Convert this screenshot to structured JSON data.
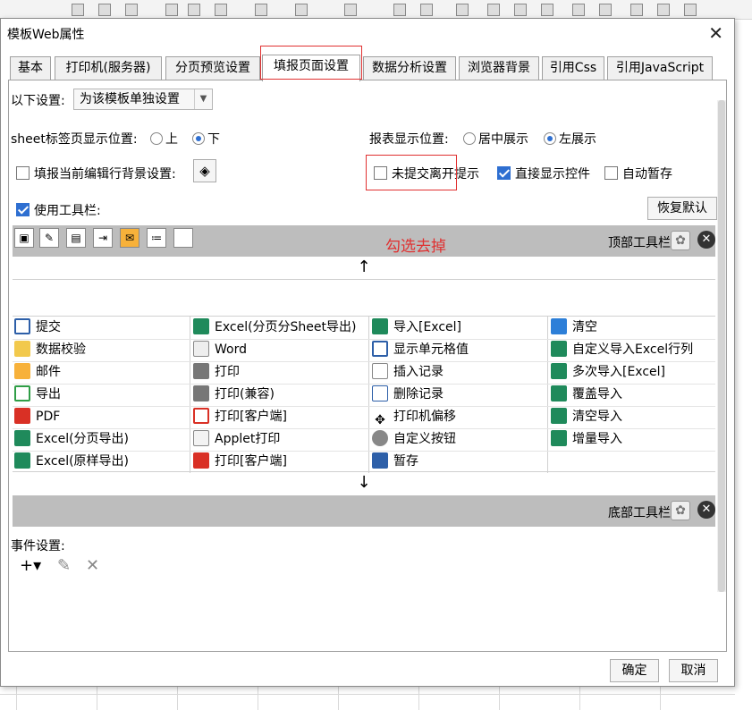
{
  "window": {
    "title": "模板Web属性"
  },
  "tabs": [
    "基本",
    "打印机(服务器)",
    "分页预览设置",
    "填报页面设置",
    "数据分析设置",
    "浏览器背景",
    "引用Css",
    "引用JavaScript"
  ],
  "settings": {
    "scope_label": "以下设置:",
    "scope_value": "为该模板单独设置",
    "sheet_pos_label": "sheet标签页显示位置:",
    "sheet_pos_top": "上",
    "sheet_pos_bottom": "下",
    "report_pos_label": "报表显示位置:",
    "report_pos_center": "居中展示",
    "report_pos_left": "左展示",
    "row_bg_label": "填报当前编辑行背景设置:",
    "unsubmitted_label": "未提交离开提示",
    "direct_controls_label": "直接显示控件",
    "autosave_label": "自动暂存",
    "use_toolbar_label": "使用工具栏:",
    "restore_default": "恢复默认",
    "annotation": "勾选去掉"
  },
  "toolbar": {
    "top_label": "顶部工具栏",
    "bottom_label": "底部工具栏",
    "up_arrow": "↑",
    "down_arrow": "↓"
  },
  "buttons": {
    "col1": [
      "提交",
      "数据校验",
      "邮件",
      "导出",
      "PDF",
      "Excel(分页导出)",
      "Excel(原样导出)"
    ],
    "col2": [
      "Excel(分页分Sheet导出)",
      "Word",
      "打印",
      "打印(兼容)",
      "打印[客户端]",
      "Applet打印",
      "打印[客户端]"
    ],
    "col3": [
      "导入[Excel]",
      "显示单元格值",
      "插入记录",
      "删除记录",
      "打印机偏移",
      "自定义按钮",
      "暂存"
    ],
    "col4": [
      "清空",
      "自定义导入Excel行列",
      "多次导入[Excel]",
      "覆盖导入",
      "清空导入",
      "增量导入"
    ]
  },
  "events": {
    "label": "事件设置:",
    "add": "+▾",
    "edit": "✎",
    "delete": "✕"
  },
  "footer": {
    "ok": "确定",
    "cancel": "取消"
  }
}
